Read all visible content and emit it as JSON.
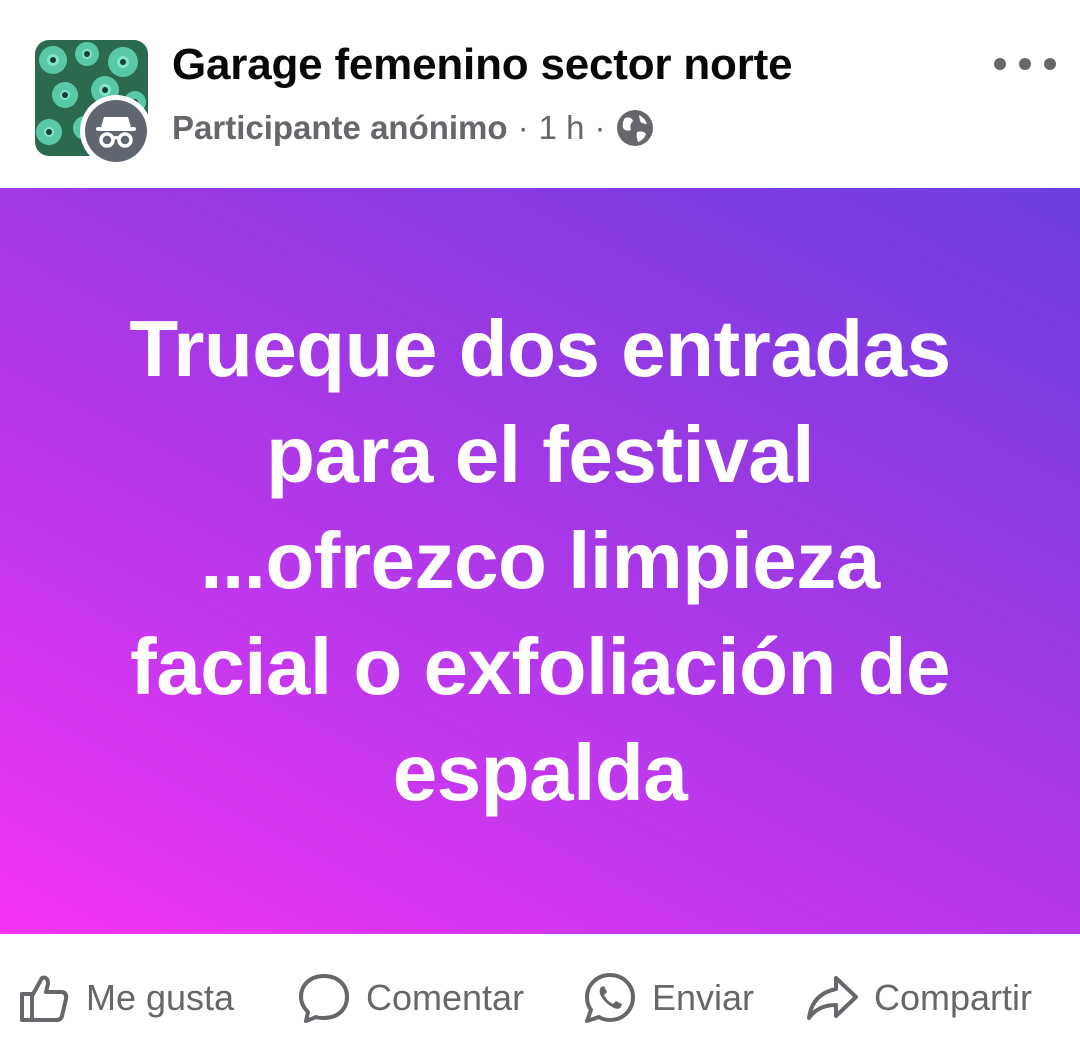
{
  "header": {
    "group_name": "Garage femenino sector norte",
    "author": "Participante anónimo",
    "separator": "·",
    "time": "1 h",
    "privacy_icon": "globe-icon",
    "group_avatar_icon": "flower-photo",
    "author_avatar_icon": "incognito-icon",
    "more_icon": "more-options-icon"
  },
  "post": {
    "text": "Trueque dos entradas para el festival ...ofrezco limpieza facial o exfoliación de espalda",
    "background_colors": [
      "#f532f7",
      "#c637ee",
      "#9c39e4",
      "#6b3ee0"
    ],
    "text_color": "#ffffff"
  },
  "actions": [
    {
      "label": "Me gusta",
      "icon": "thumbs-up-icon"
    },
    {
      "label": "Comentar",
      "icon": "comment-icon"
    },
    {
      "label": "Enviar",
      "icon": "whatsapp-icon"
    },
    {
      "label": "Compartir",
      "icon": "share-icon"
    }
  ],
  "colors": {
    "primary_text": "#080809",
    "secondary_text": "#65676b"
  }
}
